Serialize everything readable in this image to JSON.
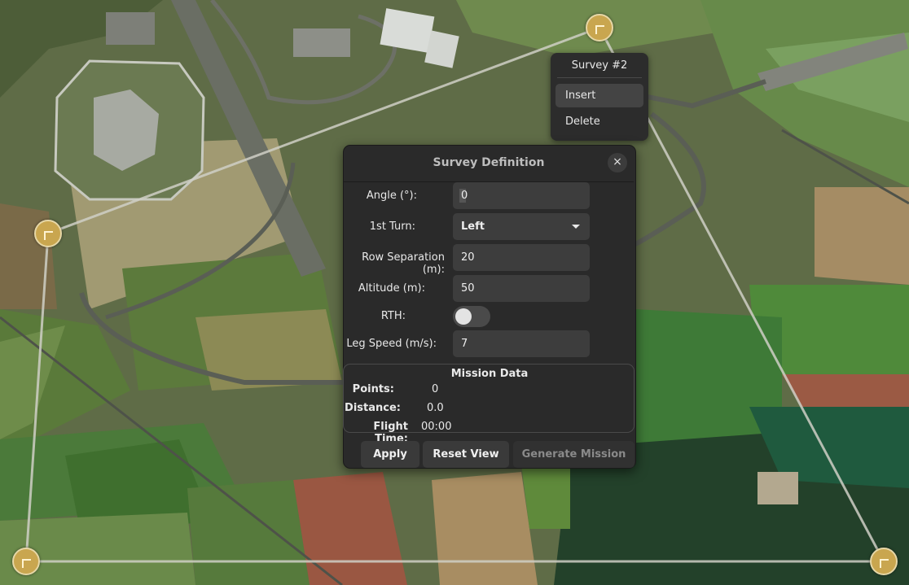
{
  "context_menu": {
    "title": "Survey #2",
    "items": [
      "Insert",
      "Delete"
    ]
  },
  "dialog": {
    "title": "Survey Definition",
    "close_glyph": "×",
    "fields": {
      "angle": {
        "label": "Angle (°):",
        "value": "0"
      },
      "first_turn": {
        "label": "1st Turn:",
        "value": "Left"
      },
      "row_separation": {
        "label": "Row Separation (m):",
        "value": "20"
      },
      "altitude": {
        "label": "Altitude (m):",
        "value": "50"
      },
      "rth": {
        "label": "RTH:",
        "enabled": false
      },
      "leg_speed": {
        "label": "Leg Speed (m/s):",
        "value": "7"
      }
    },
    "mission_data": {
      "title": "Mission Data",
      "points": {
        "label": "Points:",
        "value": "0"
      },
      "distance": {
        "label": "Distance:",
        "value": "0.0"
      },
      "flight_time": {
        "label": "Flight Time:",
        "value": "00:00"
      }
    },
    "buttons": {
      "apply": "Apply",
      "reset_view": "Reset View",
      "generate_mission": "Generate Mission"
    }
  },
  "colors": {
    "waypoint_fill": "#c9a64f",
    "polygon_line": "#c8c8c0",
    "dialog_bg": "#2a2a2a"
  }
}
